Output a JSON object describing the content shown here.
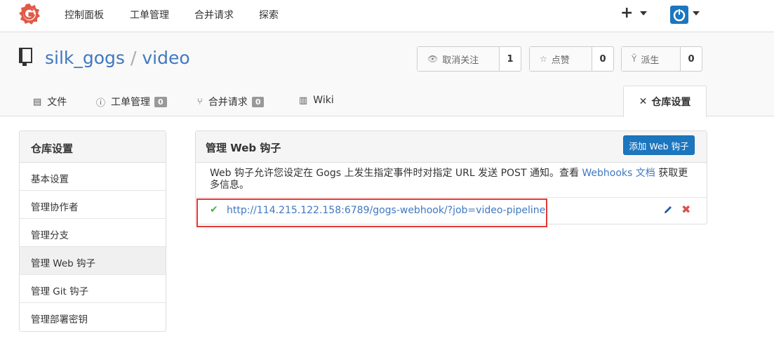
{
  "topnav": {
    "links": [
      "控制面板",
      "工单管理",
      "合并请求",
      "探索"
    ],
    "plus": "+"
  },
  "repo": {
    "owner": "silk_gogs",
    "separator": "/",
    "name": "video"
  },
  "actions": {
    "watch_label": "取消关注",
    "watch_count": "1",
    "star_label": "点赞",
    "star_count": "0",
    "fork_label": "派生",
    "fork_count": "0"
  },
  "tabs": {
    "files": "文件",
    "issues": "工单管理",
    "issues_count": "0",
    "pulls": "合并请求",
    "pulls_count": "0",
    "wiki": "Wiki",
    "settings": "仓库设置"
  },
  "sidebar": {
    "title": "仓库设置",
    "items": [
      {
        "label": "基本设置"
      },
      {
        "label": "管理协作者"
      },
      {
        "label": "管理分支"
      },
      {
        "label": "管理 Web 钩子"
      },
      {
        "label": "管理 Git 钩子"
      },
      {
        "label": "管理部署密钥"
      }
    ]
  },
  "panel": {
    "title": "管理 Web 钩子",
    "add_button": "添加 Web 钩子",
    "desc_before": "Web 钩子允许您设定在 Gogs 上发生指定事件时对指定 URL 发送 POST 通知。查看 ",
    "desc_link": "Webhooks 文档",
    "desc_after": " 获取更多信息。",
    "hook_url": "http://114.215.122.158:6789/gogs-webhook/?job=video-pipeline"
  },
  "colors": {
    "accent": "#1c76bf",
    "link": "#4078c0",
    "success": "#4cae4c",
    "danger": "#d9534f",
    "highlight_box": "#e53935"
  }
}
